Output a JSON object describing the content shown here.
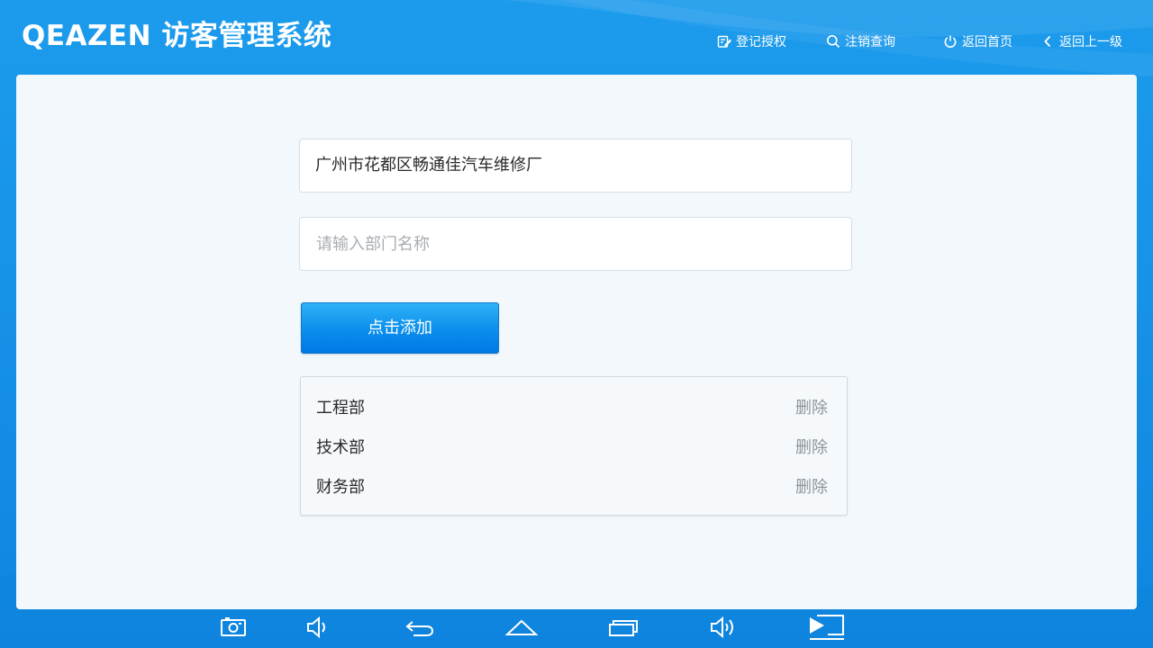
{
  "app": {
    "title": "QEAZEN 访客管理系统"
  },
  "nav": {
    "register_label": "登记授权",
    "cancel_label": "注销查询",
    "home_label": "返回首页",
    "back_label": "返回上一级"
  },
  "form": {
    "company_value": "广州市花都区畅通佳汽车维修厂",
    "department_placeholder": "请输入部门名称",
    "department_value": "",
    "add_button_label": "点击添加"
  },
  "departments": [
    {
      "name": "工程部",
      "action": "删除"
    },
    {
      "name": "技术部",
      "action": "删除"
    },
    {
      "name": "财务部",
      "action": "删除"
    }
  ],
  "system_bar": {
    "icons": [
      "screenshot-icon",
      "volume-down-icon",
      "back-icon",
      "home-icon",
      "recent-apps-icon",
      "volume-up-icon",
      "screen-cast-icon"
    ]
  },
  "colors": {
    "header_blue": "#1590e6",
    "panel_background": "#f2f8fc",
    "button_blue": "#0a8eec",
    "delete_gray": "#8e9499"
  }
}
